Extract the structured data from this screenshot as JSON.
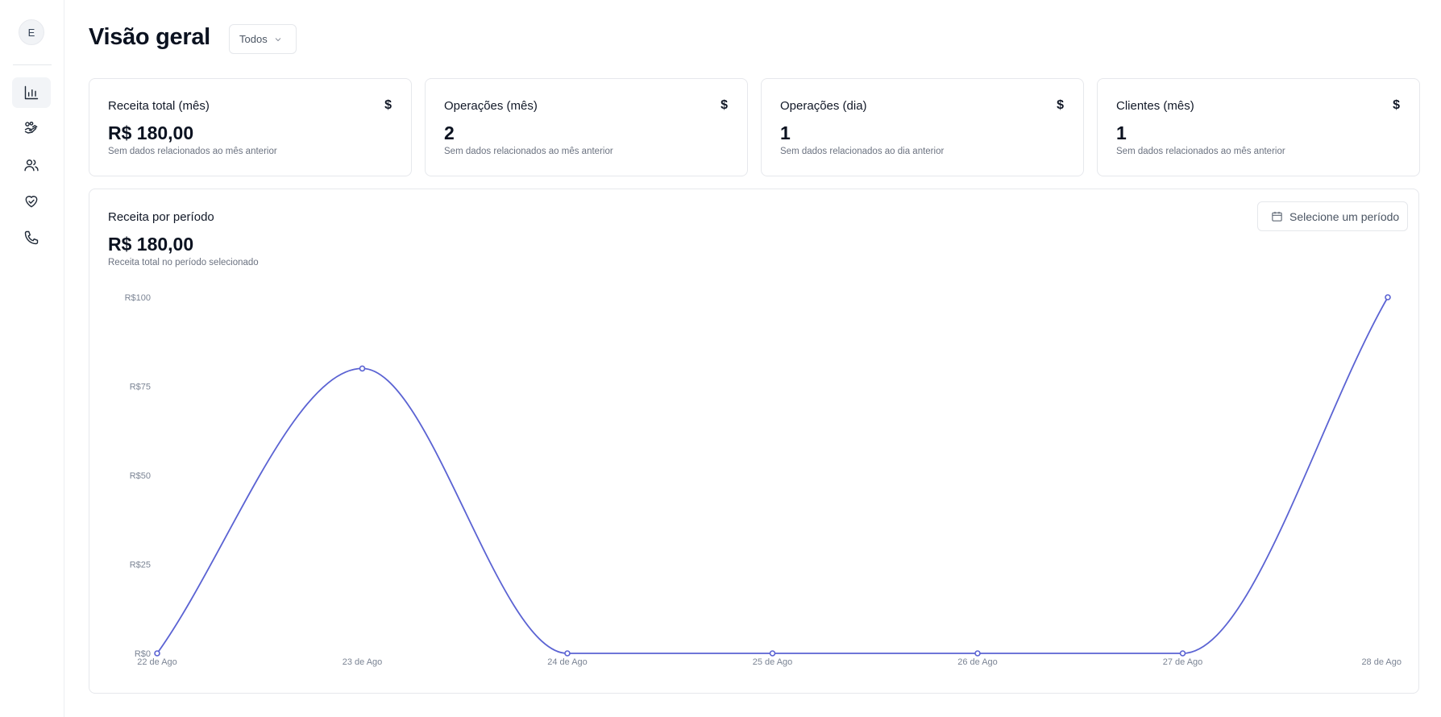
{
  "sidebar": {
    "avatar_initial": "E",
    "items": [
      {
        "name": "chart",
        "icon": "bar-chart-icon",
        "active": true
      },
      {
        "name": "operations",
        "icon": "hand-coins-icon",
        "active": false
      },
      {
        "name": "clients",
        "icon": "users-icon",
        "active": false
      },
      {
        "name": "partners",
        "icon": "handshake-heart-icon",
        "active": false
      },
      {
        "name": "contacts",
        "icon": "phone-icon",
        "active": false
      }
    ]
  },
  "header": {
    "title": "Visão geral",
    "filter_value": "Todos"
  },
  "cards": [
    {
      "title": "Receita total (mês)",
      "icon": "$",
      "value": "R$ 180,00",
      "note": "Sem dados relacionados ao mês anterior"
    },
    {
      "title": "Operações (mês)",
      "icon": "$",
      "value": "2",
      "note": "Sem dados relacionados ao mês anterior"
    },
    {
      "title": "Operações (dia)",
      "icon": "$",
      "value": "1",
      "note": "Sem dados relacionados ao dia anterior"
    },
    {
      "title": "Clientes (mês)",
      "icon": "$",
      "value": "1",
      "note": "Sem dados relacionados ao mês anterior"
    }
  ],
  "revenue_chart": {
    "title": "Receita por período",
    "value": "R$ 180,00",
    "note": "Receita total no período selecionado",
    "period_button": "Selecione um período"
  },
  "colors": {
    "line": "#5b63d3"
  },
  "chart_data": {
    "type": "line",
    "x": [
      "22 de Ago",
      "23 de Ago",
      "24 de Ago",
      "25 de Ago",
      "26 de Ago",
      "27 de Ago",
      "28 de Ago"
    ],
    "series": [
      {
        "values": [
          0,
          80,
          0,
          0,
          0,
          0,
          100
        ]
      }
    ],
    "yticks": [
      0,
      25,
      50,
      75,
      100
    ],
    "ytick_labels": [
      "R$0",
      "R$25",
      "R$50",
      "R$75",
      "R$100"
    ],
    "ylim": [
      0,
      100
    ],
    "grid": false,
    "legend": "none"
  }
}
